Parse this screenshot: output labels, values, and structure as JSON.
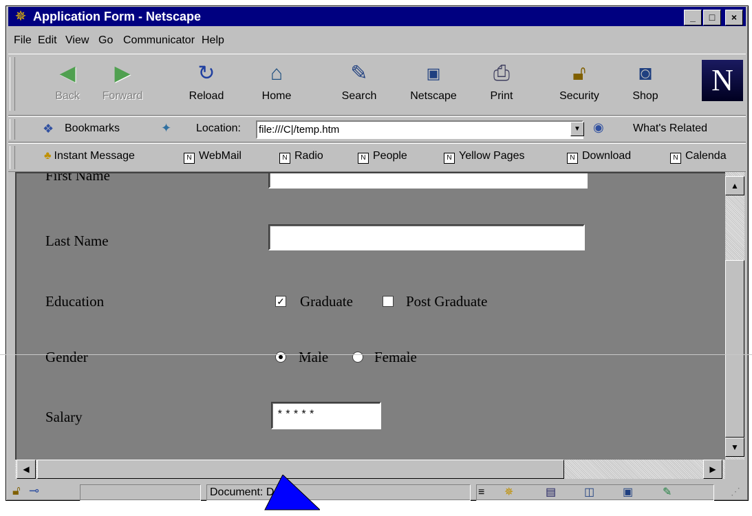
{
  "window": {
    "title": "Application Form - Netscape",
    "buttons": [
      "_",
      "□",
      "×"
    ]
  },
  "menu": [
    "File",
    "Edit",
    "View",
    "Go",
    "Communicator",
    "Help"
  ],
  "navigation_toolbar": [
    {
      "label": "Back",
      "icon": "back-arrow-icon",
      "enabled": false
    },
    {
      "label": "Forward",
      "icon": "forward-arrow-icon",
      "enabled": false
    },
    {
      "label": "Reload",
      "icon": "reload-icon",
      "enabled": true
    },
    {
      "label": "Home",
      "icon": "home-icon",
      "enabled": true
    },
    {
      "label": "Search",
      "icon": "search-icon",
      "enabled": true
    },
    {
      "label": "Netscape",
      "icon": "my-netscape-icon",
      "enabled": true
    },
    {
      "label": "Print",
      "icon": "printer-icon",
      "enabled": true
    },
    {
      "label": "Security",
      "icon": "lock-icon",
      "enabled": true
    },
    {
      "label": "Shop",
      "icon": "shop-bag-icon",
      "enabled": true
    }
  ],
  "logo_letter": "N",
  "location_bar": {
    "bookmarks_label": "Bookmarks",
    "location_label": "Location:",
    "url": "file:///C|/temp.htm",
    "whats_related": "What's Related"
  },
  "personal_toolbar": [
    "Instant Message",
    "WebMail",
    "Radio",
    "People",
    "Yellow Pages",
    "Download",
    "Calenda"
  ],
  "form": {
    "first_name_label": "First Name",
    "first_name_value": "",
    "last_name_label": "Last Name",
    "last_name_value": "",
    "education_label": "Education",
    "education_options": [
      {
        "label": "Graduate",
        "checked": true
      },
      {
        "label": "Post Graduate",
        "checked": false
      }
    ],
    "gender_label": "Gender",
    "gender_options": [
      {
        "label": "Male",
        "selected": true
      },
      {
        "label": "Female",
        "selected": false
      }
    ],
    "salary_label": "Salary",
    "salary_value": "*****"
  },
  "status_bar": {
    "text": "Document: Done"
  },
  "colors": {
    "titlebar": "#000080",
    "chrome": "#c0c0c0",
    "page_background": "#808080",
    "cursor_shape": "#0000ff"
  }
}
